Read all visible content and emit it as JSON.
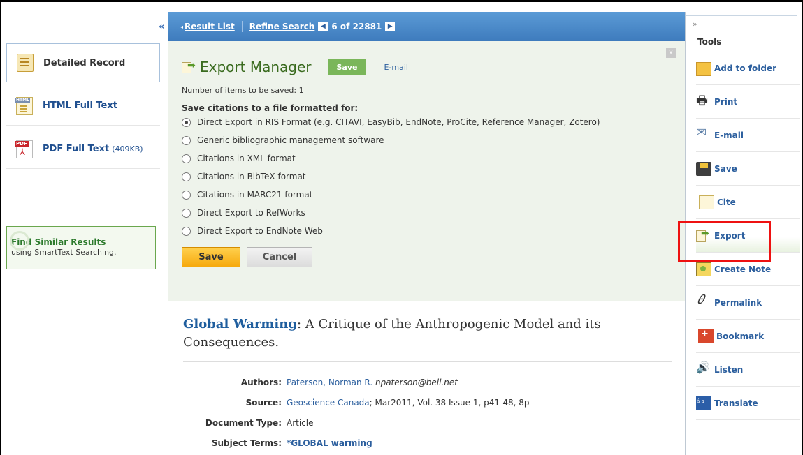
{
  "left": {
    "collapse": "«",
    "nav": [
      {
        "label": "Detailed Record",
        "extra": ""
      },
      {
        "label": "HTML Full Text",
        "extra": ""
      },
      {
        "label": "PDF Full Text",
        "extra": "(409KB)"
      }
    ],
    "similar": {
      "link": "Find Similar Results",
      "sub": "using SmartText Searching."
    }
  },
  "topbar": {
    "result_list": "Result List",
    "refine": "Refine Search",
    "position": "6 of 22881"
  },
  "export": {
    "title": "Export Manager",
    "save_btn": "Save",
    "email": "E-mail",
    "close": "x",
    "count": "Number of items to be saved: 1",
    "format_title": "Save citations to a file formatted for:",
    "options": [
      "Direct Export in RIS Format (e.g. CITAVI, EasyBib, EndNote, ProCite, Reference Manager, Zotero)",
      "Generic bibliographic management software",
      "Citations in XML format",
      "Citations in BibTeX format",
      "Citations in MARC21 format",
      "Direct Export to RefWorks",
      "Direct Export to EndNote Web"
    ],
    "selected_index": 0,
    "save": "Save",
    "cancel": "Cancel"
  },
  "record": {
    "title_bold": "Global Warming",
    "title_rest": ": A Critique of the Anthropogenic Model and its Consequences.",
    "authors_key": "Authors:",
    "authors_name": "Paterson, Norman R.",
    "authors_email": "npaterson@bell.net",
    "source_key": "Source:",
    "source_link": "Geoscience Canada",
    "source_rest": "; Mar2011, Vol. 38 Issue 1, p41-48, 8p",
    "doctype_key": "Document Type:",
    "doctype_val": "Article",
    "subject_key": "Subject Terms:",
    "subject_val": "*GLOBAL warming"
  },
  "tools": {
    "expand": "»",
    "title": "Tools",
    "items": [
      "Add to folder",
      "Print",
      "E-mail",
      "Save",
      "Cite",
      "Export",
      "Create Note",
      "Permalink",
      "Bookmark",
      "Listen",
      "Translate"
    ]
  }
}
